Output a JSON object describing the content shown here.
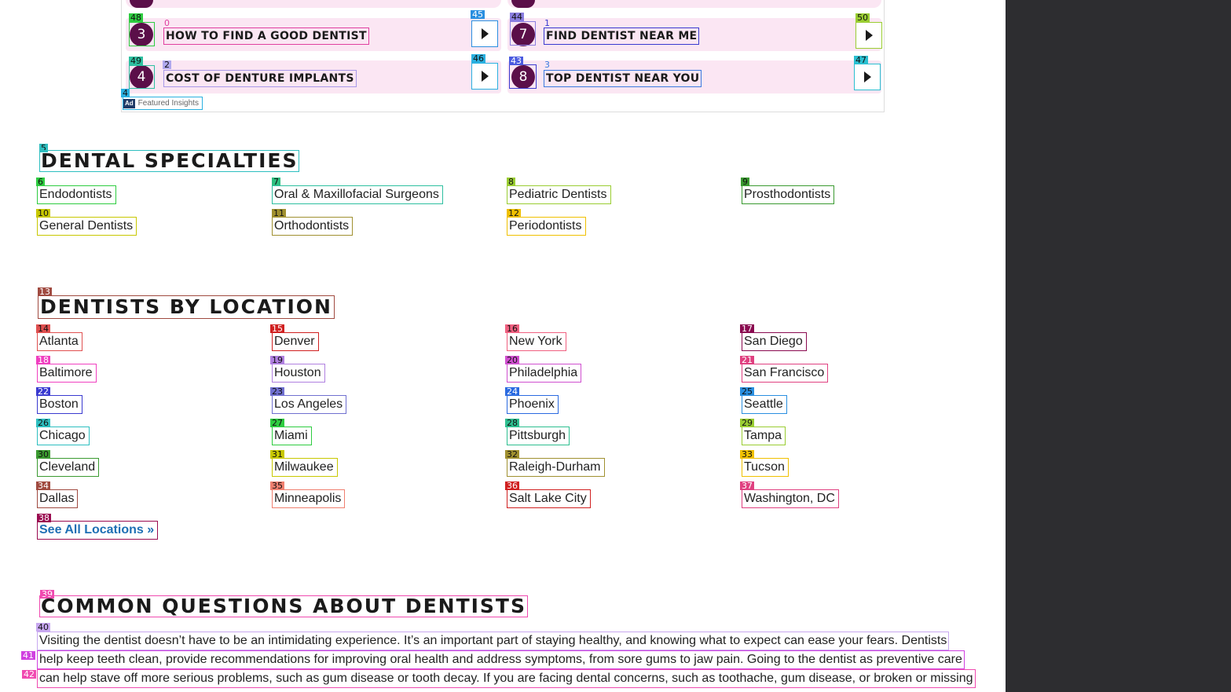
{
  "ads": {
    "rows": [
      {
        "number": "3",
        "text": "HOW TO FIND A GOOD DENTIST"
      },
      {
        "number": "7",
        "text": "FIND DENTIST NEAR ME"
      },
      {
        "number": "4",
        "text": "COST OF DENTURE IMPLANTS"
      },
      {
        "number": "8",
        "text": "TOP DENTIST NEAR YOU"
      }
    ],
    "badge_icon": "Ad",
    "badge_label": "Featured Insights"
  },
  "specialties": {
    "title": "DENTAL SPECIALTIES",
    "items": [
      "Endodontists",
      "Oral & Maxillofacial Surgeons",
      "Pediatric Dentists",
      "Prosthodontists",
      "General Dentists",
      "Orthodontists",
      "Periodontists"
    ]
  },
  "locations": {
    "title": "DENTISTS BY LOCATION",
    "items": [
      "Atlanta",
      "Denver",
      "New York",
      "San Diego",
      "Baltimore",
      "Houston",
      "Philadelphia",
      "San Francisco",
      "Boston",
      "Los Angeles",
      "Phoenix",
      "Seattle",
      "Chicago",
      "Miami",
      "Pittsburgh",
      "Tampa",
      "Cleveland",
      "Milwaukee",
      "Raleigh-Durham",
      "Tucson",
      "Dallas",
      "Minneapolis",
      "Salt Lake City",
      "Washington, DC"
    ],
    "see_all": "See All Locations »"
  },
  "questions": {
    "title": "COMMON QUESTIONS ABOUT DENTISTS",
    "lines": [
      "Visiting the dentist doesn’t have to be an intimidating experience. It’s an important part of staying healthy, and knowing what to expect can ease your fears. Dentists",
      "help keep teeth clean, provide recommendations for improving oral health and address symptoms, from sore gums to jaw pain. Going to the dentist as preventive care",
      "can help stave off more serious problems, such as gum disease or tooth decay. If you are facing dental concerns, such as toothache, gum disease, or broken or missing"
    ]
  },
  "marks": {
    "m0": "0",
    "m1": "1",
    "m2": "2",
    "m3": "3",
    "m4": "4",
    "m5": "5",
    "m6": "6",
    "m7": "7",
    "m8": "8",
    "m9": "9",
    "m10": "10",
    "m11": "11",
    "m12": "12",
    "m13": "13",
    "m14": "14",
    "m15": "15",
    "m16": "16",
    "m17": "17",
    "m18": "18",
    "m19": "19",
    "m20": "20",
    "m21": "21",
    "m22": "22",
    "m23": "23",
    "m24": "24",
    "m25": "25",
    "m26": "26",
    "m27": "27",
    "m28": "28",
    "m29": "29",
    "m30": "30",
    "m31": "31",
    "m32": "32",
    "m33": "33",
    "m34": "34",
    "m35": "35",
    "m36": "36",
    "m37": "37",
    "m38": "38",
    "m39": "39",
    "m40": "40",
    "m41": "41",
    "m42": "42",
    "m43": "43",
    "m44": "44",
    "m45": "45",
    "m46": "46",
    "m47": "47",
    "m48": "48",
    "m49": "49",
    "m50": "50"
  },
  "colors": {
    "circle": "#5b0f49",
    "ad_row": "#fbe6f3",
    "link": "#1e6fb4",
    "side_panel": "#2d2d30"
  }
}
